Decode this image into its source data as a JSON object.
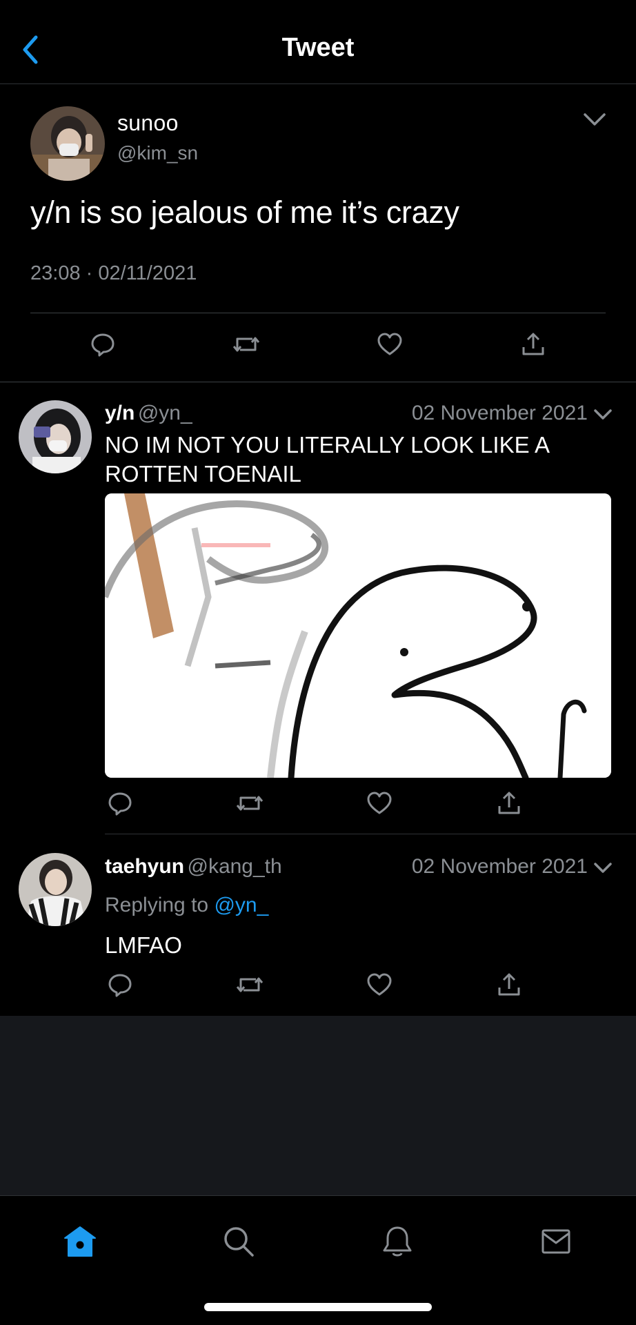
{
  "header": {
    "title": "Tweet"
  },
  "main_tweet": {
    "name": "sunoo",
    "handle": "@kim_sn",
    "text": "y/n is so jealous of me it’s crazy",
    "timestamp": "23:08 · 02/11/2021"
  },
  "replies": [
    {
      "name": "y/n",
      "handle": "@yn_",
      "date": "02 November 2021",
      "text_line1": "NO IM NOT YOU LITERALLY LOOK LIKE A",
      "text_line2": "ROTTEN TOENAIL",
      "has_media": true
    },
    {
      "name": "taehyun",
      "handle": "@kang_th",
      "date": "02 November 2021",
      "replying_prefix": "Replying to",
      "replying_mention": "@yn_",
      "text": "LMFAO"
    }
  ],
  "icons": [
    "back-chevron-icon",
    "chevron-down-icon",
    "reply-icon",
    "retweet-icon",
    "like-icon",
    "share-icon",
    "home-icon",
    "search-icon",
    "notifications-icon",
    "messages-icon"
  ],
  "colors": {
    "accent": "#1d9bf0",
    "background": "#000000",
    "muted_text": "#8b8f94",
    "divider": "#2f3336"
  }
}
